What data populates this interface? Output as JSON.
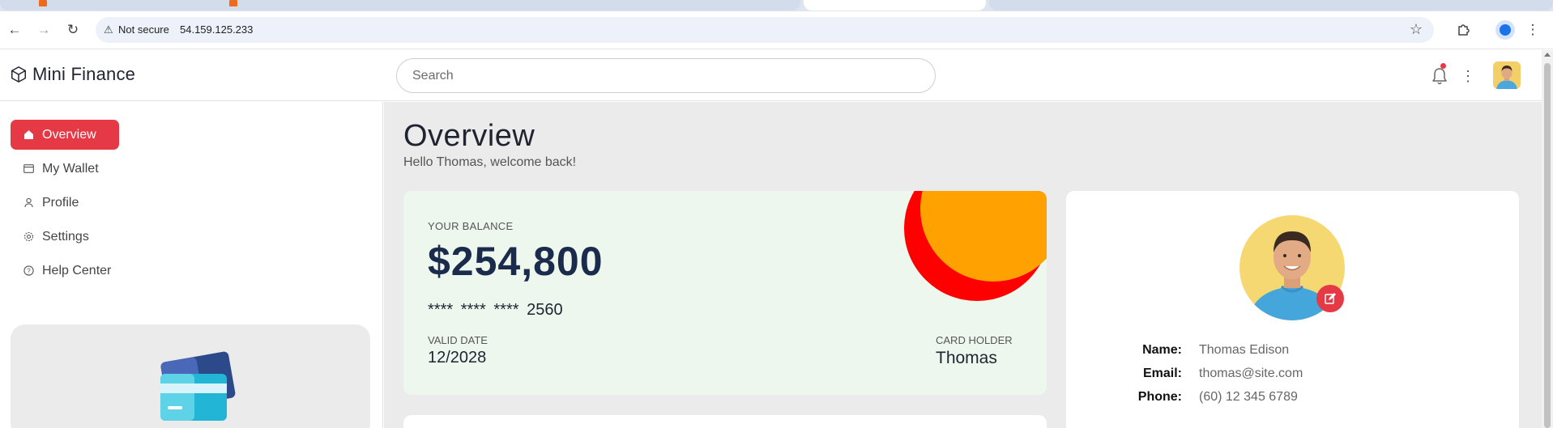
{
  "browser": {
    "omnibox": {
      "security_label": "Not secure",
      "url": "54.159.125.233"
    },
    "icons": [
      "back-arrow-icon",
      "forward-arrow-icon",
      "reload-icon",
      "warning-icon",
      "star-icon",
      "extensions-icon",
      "profile-icon",
      "menu-icon"
    ]
  },
  "header": {
    "brand_name": "Mini Finance",
    "search_placeholder": "Search",
    "notification_dot_color": "#e63946"
  },
  "sidebar": {
    "items": [
      {
        "label": "Overview",
        "icon": "home-icon",
        "active": true
      },
      {
        "label": "My Wallet",
        "icon": "wallet-icon",
        "active": false
      },
      {
        "label": "Profile",
        "icon": "person-icon",
        "active": false
      },
      {
        "label": "Settings",
        "icon": "gear-icon",
        "active": false
      },
      {
        "label": "Help Center",
        "icon": "help-icon",
        "active": false
      }
    ]
  },
  "main": {
    "title": "Overview",
    "subtitle": "Hello Thomas, welcome back!",
    "balance_card": {
      "balance_label": "YOUR BALANCE",
      "balance": "$254,800",
      "card_number": "**** **** **** 2560",
      "valid_label": "VALID DATE",
      "valid_date": "12/2028",
      "holder_label": "CARD HOLDER",
      "holder": "Thomas"
    },
    "profile_card": {
      "name_label": "Name:",
      "name": "Thomas Edison",
      "email_label": "Email:",
      "email": "thomas@site.com",
      "phone_label": "Phone:",
      "phone": "(60) 12 345 6789"
    }
  },
  "colors": {
    "accent": "#e63946",
    "balance_card_bg": "#eef7ee",
    "balance_text": "#1b2b4b",
    "decor_red": "#ff0000",
    "decor_orange": "#ffa100"
  }
}
